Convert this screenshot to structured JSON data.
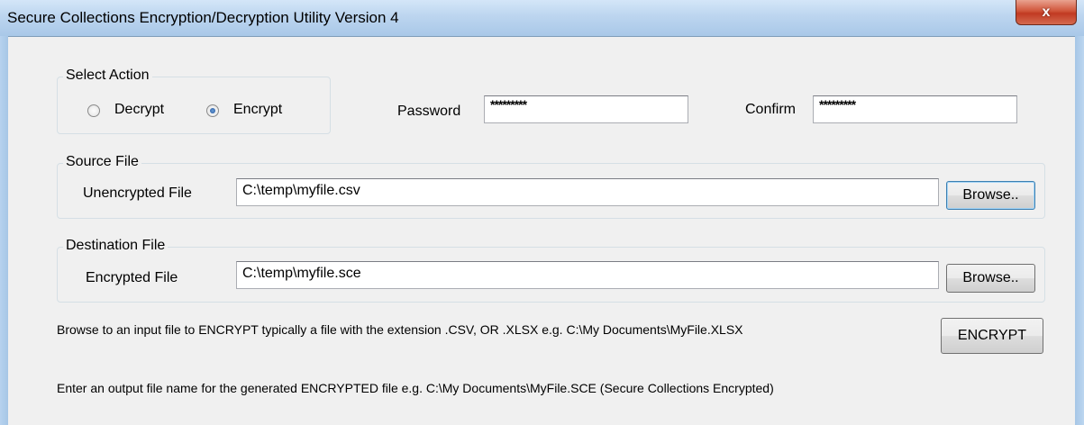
{
  "window": {
    "title": "Secure Collections Encryption/Decryption Utility Version 4",
    "close_glyph": "x"
  },
  "action_group": {
    "label": "Select Action",
    "options": [
      {
        "label": "Decrypt",
        "selected": false
      },
      {
        "label": "Encrypt",
        "selected": true
      }
    ]
  },
  "password": {
    "label": "Password",
    "value": "*********"
  },
  "confirm": {
    "label": "Confirm",
    "value": "*********"
  },
  "source": {
    "group_label": "Source File",
    "field_label": "Unencrypted File",
    "value": "C:\\temp\\myfile.csv",
    "browse_label": "Browse.."
  },
  "destination": {
    "group_label": "Destination File",
    "field_label": "Encrypted File",
    "value": "C:\\temp\\myfile.sce",
    "browse_label": "Browse.."
  },
  "instructions": {
    "input_hint": "Browse to an input file to ENCRYPT typically a file with the extension .CSV, OR .XLSX e.g. C:\\My Documents\\MyFile.XLSX",
    "output_hint": "Enter an output file name for the generated ENCRYPTED file e.g. C:\\My Documents\\MyFile.SCE (Secure Collections Encrypted)"
  },
  "action_button": {
    "label": "ENCRYPT"
  },
  "colors": {
    "title_bar": "#bcd5ef",
    "close_button": "#c13a22",
    "client_background": "#f0f0f0"
  }
}
